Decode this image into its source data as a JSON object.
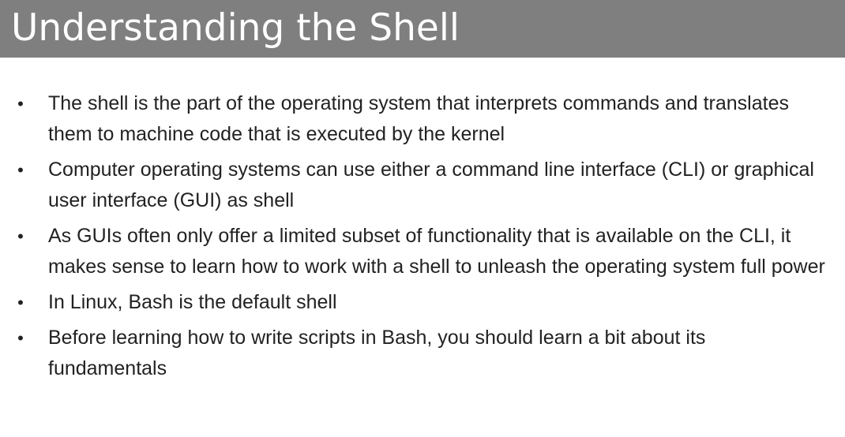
{
  "slide": {
    "title": "Understanding the Shell",
    "bullets": [
      {
        "text": "The shell is the part of the operating system that interprets commands and translates them to machine code that is executed by the kernel"
      },
      {
        "text": "Computer operating systems can use either a command line interface (CLI) or graphical user interface (GUI) as shell"
      },
      {
        "text": "As GUIs often only offer a limited subset of functionality that is available on the CLI, it makes sense to learn how to work with a shell to unleash the operating system full power"
      },
      {
        "text": "In Linux, Bash is the default shell"
      },
      {
        "text": "Before learning how to write scripts in Bash, you should learn a bit about its fundamentals"
      }
    ],
    "bullet_glyph": "•"
  },
  "colors": {
    "title_bar": "#7f7f7f",
    "title_text": "#ffffff",
    "body_text": "#222222",
    "background": "#ffffff"
  }
}
